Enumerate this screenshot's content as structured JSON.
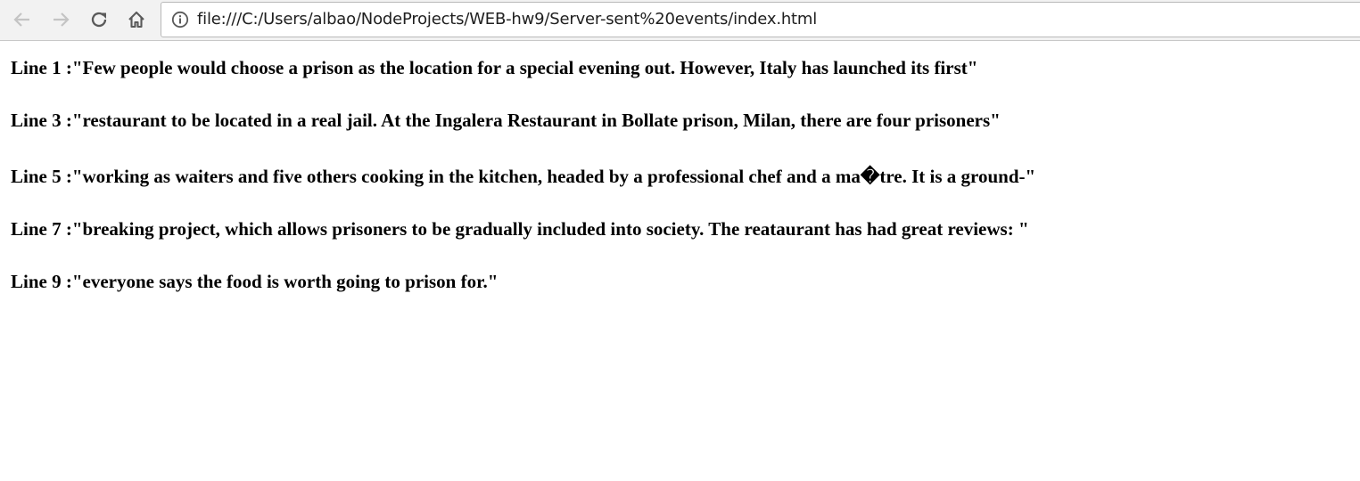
{
  "browser": {
    "url": "file:///C:/Users/albao/NodeProjects/WEB-hw9/Server-sent%20events/index.html",
    "icons": [
      "back-arrow-icon",
      "forward-arrow-icon",
      "reload-icon",
      "home-icon",
      "info-icon"
    ]
  },
  "page": {
    "lines": [
      "Line 1 :\"Few people would choose a prison as the location for a special evening out. However, Italy has launched its first\"",
      "Line 3 :\"restaurant to be located in a real jail. At the Ingalera Restaurant in Bollate prison, Milan, there are four prisoners\"",
      "Line 5 :\"working as waiters and five others cooking in the kitchen, headed by a professional chef and a ma�tre. It is a ground-\"",
      "Line 7 :\"breaking project, which allows prisoners to be gradually included into society. The reataurant has had great reviews: \"",
      "Line 9 :\"everyone says the food is worth going to prison for.\""
    ]
  }
}
